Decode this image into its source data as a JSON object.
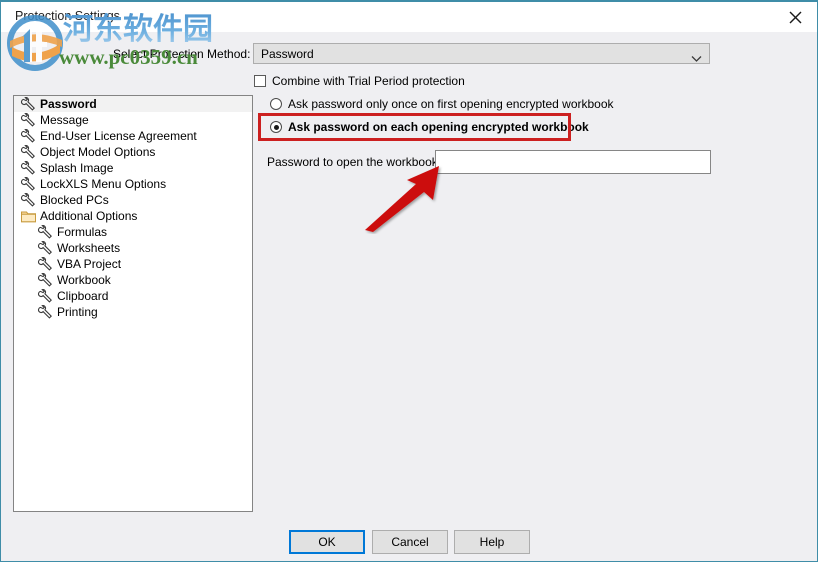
{
  "window": {
    "title": "Protection Settings",
    "close_icon": "close-icon",
    "accent_border": "#3f8da8",
    "body_background": "#efeff2"
  },
  "watermark": {
    "chinese_text": "河东软件园",
    "url_text": "www.pc0359.cn",
    "logo_icon": "site-logo-icon",
    "chinese_color": "#5ca2d8",
    "url_color": "#4a8a3a"
  },
  "tree": {
    "items": [
      {
        "label": "Password",
        "icon": "wrench-icon",
        "selected": true,
        "indent": false
      },
      {
        "label": "Message",
        "icon": "wrench-icon",
        "selected": false,
        "indent": false
      },
      {
        "label": "End-User License Agreement",
        "icon": "wrench-icon",
        "selected": false,
        "indent": false
      },
      {
        "label": "Object Model Options",
        "icon": "wrench-icon",
        "selected": false,
        "indent": false
      },
      {
        "label": "Splash Image",
        "icon": "wrench-icon",
        "selected": false,
        "indent": false
      },
      {
        "label": "LockXLS Menu Options",
        "icon": "wrench-icon",
        "selected": false,
        "indent": false
      },
      {
        "label": "Blocked PCs",
        "icon": "wrench-icon",
        "selected": false,
        "indent": false
      },
      {
        "label": "Additional Options",
        "icon": "folder-icon",
        "selected": false,
        "indent": false
      },
      {
        "label": "Formulas",
        "icon": "wrench-icon",
        "selected": false,
        "indent": true
      },
      {
        "label": "Worksheets",
        "icon": "wrench-icon",
        "selected": false,
        "indent": true
      },
      {
        "label": "VBA Project",
        "icon": "wrench-icon",
        "selected": false,
        "indent": true
      },
      {
        "label": "Workbook",
        "icon": "wrench-icon",
        "selected": false,
        "indent": true
      },
      {
        "label": "Clipboard",
        "icon": "wrench-icon",
        "selected": false,
        "indent": true
      },
      {
        "label": "Printing",
        "icon": "wrench-icon",
        "selected": false,
        "indent": true
      }
    ]
  },
  "form": {
    "select_protection_method_label": "Select Protection Method:",
    "protection_method_value": "Password",
    "protection_method_arrow_icon": "chevron-down-icon",
    "combine_trial_checkbox_label": "Combine with Trial Period protection",
    "combine_trial_checked": false,
    "radio_once_label": "Ask password only once on first opening encrypted workbook",
    "radio_each_label": "Ask password on each opening encrypted workbook",
    "radio_selected": "each",
    "password_label": "Password to open the workbook:",
    "password_value": "",
    "password_placeholder": ""
  },
  "annotations": {
    "highlight_color": "#cc2020",
    "arrow_color": "#cc1111",
    "highlight_target": "radio-each",
    "arrow_target": "password-input"
  },
  "buttons": {
    "ok": "OK",
    "cancel": "Cancel",
    "help": "Help",
    "focus_color": "#0078d7"
  }
}
